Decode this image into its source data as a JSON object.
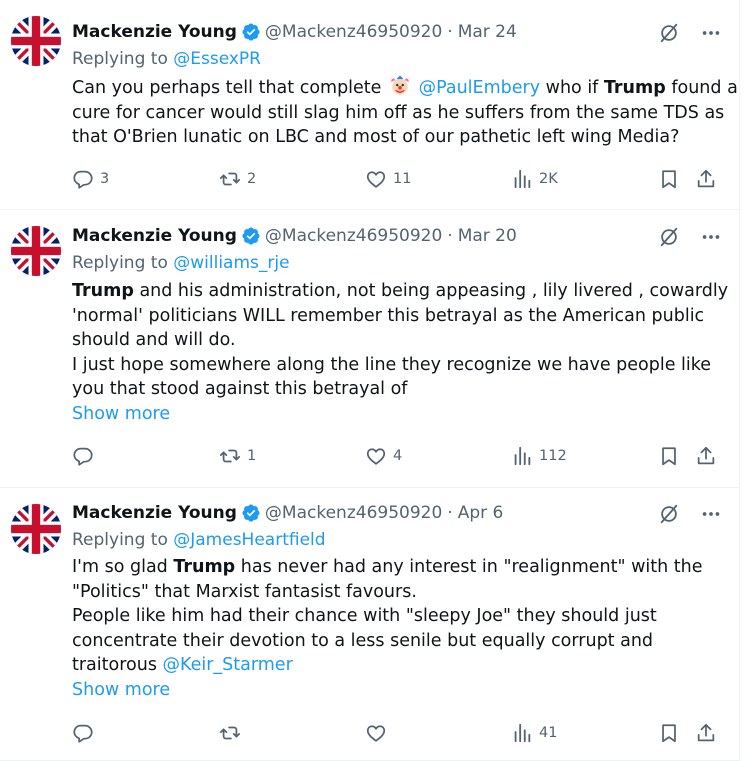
{
  "colors": {
    "link": "#1d9bf0",
    "muted": "#536471",
    "text": "#0f1419",
    "verified": "#1d9bf0"
  },
  "icons": [
    "union-jack-avatar",
    "verified-badge-icon",
    "grok-icon",
    "more-icon",
    "reply-icon",
    "retweet-icon",
    "like-icon",
    "views-icon",
    "bookmark-icon",
    "share-icon",
    "clown-emoji"
  ],
  "tweets": [
    {
      "name": "Mackenzie Young",
      "handle": "@Mackenz46950920",
      "sep": "·",
      "date": "Mar 24",
      "replying_prefix": "Replying to",
      "replying_to": "@EssexPR",
      "lines": {
        "l1_a": "Can you perhaps tell that complete",
        "l1_mention": "@PaulEmbery",
        "l1_b": " who if ",
        "l1_bold": "Trump",
        "l1_c": " found a",
        "l2": "cure for cancer would still slag him off as he suffers from the same TDS as",
        "l3": "that O'Brien lunatic on LBC and most of our pathetic left wing Media?"
      },
      "stats": {
        "replies": "3",
        "reposts": "2",
        "likes": "11",
        "views": "2K"
      }
    },
    {
      "name": "Mackenzie Young",
      "handle": "@Mackenz46950920",
      "sep": "·",
      "date": "Mar 20",
      "replying_prefix": "Replying to",
      "replying_to": "@williams_rje",
      "lines": {
        "l1_bold": "Trump",
        "l1_a": " and his administration, not being appeasing , lily livered , cowardly",
        "l2": "'normal' politicians WILL remember this betrayal as the American public",
        "l3": "should and will do.",
        "l4": "I just hope somewhere along the line they recognize we have people like",
        "l5": "you that stood against this betrayal of"
      },
      "show_more": "Show more",
      "stats": {
        "replies": "",
        "reposts": "1",
        "likes": "4",
        "views": "112"
      }
    },
    {
      "name": "Mackenzie Young",
      "handle": "@Mackenz46950920",
      "sep": "·",
      "date": "Apr 6",
      "replying_prefix": "Replying to",
      "replying_to": "@JamesHeartfield",
      "lines": {
        "l1_a": "I'm so glad ",
        "l1_bold": "Trump",
        "l1_b": " has never had any interest in \"realignment\" with the",
        "l2": "\"Politics\" that Marxist fantasist favours.",
        "l3": "People like him had their chance with \"sleepy Joe\" they should just",
        "l4": "concentrate their devotion to a less senile but equally corrupt and",
        "l5_a": "traitorous ",
        "l5_mention": "@Keir_Starmer"
      },
      "show_more": "Show more",
      "stats": {
        "replies": "",
        "reposts": "",
        "likes": "",
        "views": "41"
      }
    }
  ]
}
